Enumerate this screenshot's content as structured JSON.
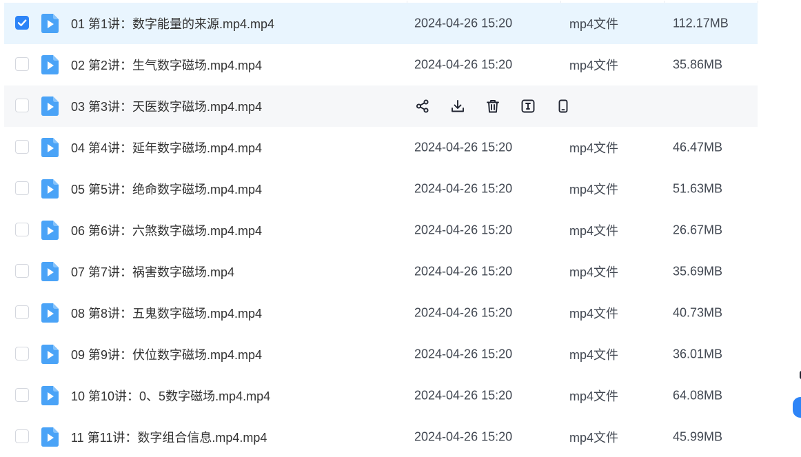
{
  "colors": {
    "accent": "#2d84f7",
    "selected_row_bg": "#e9f5fe",
    "hover_row_bg": "#f6f7f9",
    "file_icon": "#4aa3f7"
  },
  "files": [
    {
      "name": "01 第1讲：数字能量的来源.mp4.mp4",
      "date": "2024-04-26 15:20",
      "type": "mp4文件",
      "size": "112.17MB",
      "selected": true
    },
    {
      "name": "02 第2讲：生气数字磁场.mp4.mp4",
      "date": "2024-04-26 15:20",
      "type": "mp4文件",
      "size": "35.86MB"
    },
    {
      "name": "03 第3讲：天医数字磁场.mp4.mp4",
      "hover": true
    },
    {
      "name": "04 第4讲：延年数字磁场.mp4.mp4",
      "date": "2024-04-26 15:20",
      "type": "mp4文件",
      "size": "46.47MB"
    },
    {
      "name": "05 第5讲：绝命数字磁场.mp4.mp4",
      "date": "2024-04-26 15:20",
      "type": "mp4文件",
      "size": "51.63MB"
    },
    {
      "name": "06 第6讲：六煞数字磁场.mp4.mp4",
      "date": "2024-04-26 15:20",
      "type": "mp4文件",
      "size": "26.67MB"
    },
    {
      "name": "07 第7讲：祸害数字磁场.mp4",
      "date": "2024-04-26 15:20",
      "type": "mp4文件",
      "size": "35.69MB"
    },
    {
      "name": "08 第8讲：五鬼数字磁场.mp4.mp4",
      "date": "2024-04-26 15:20",
      "type": "mp4文件",
      "size": "40.73MB"
    },
    {
      "name": "09 第9讲：伏位数字磁场.mp4.mp4",
      "date": "2024-04-26 15:20",
      "type": "mp4文件",
      "size": "36.01MB"
    },
    {
      "name": "10 第10讲：0、5数字磁场.mp4.mp4",
      "date": "2024-04-26 15:20",
      "type": "mp4文件",
      "size": "64.08MB"
    },
    {
      "name": "11 第11讲：数字组合信息.mp4.mp4",
      "date": "2024-04-26 15:20",
      "type": "mp4文件",
      "size": "45.99MB"
    }
  ],
  "row_actions": [
    {
      "icon": "share-icon"
    },
    {
      "icon": "download-icon"
    },
    {
      "icon": "delete-icon"
    },
    {
      "icon": "rename-icon"
    },
    {
      "icon": "phone-icon"
    }
  ]
}
